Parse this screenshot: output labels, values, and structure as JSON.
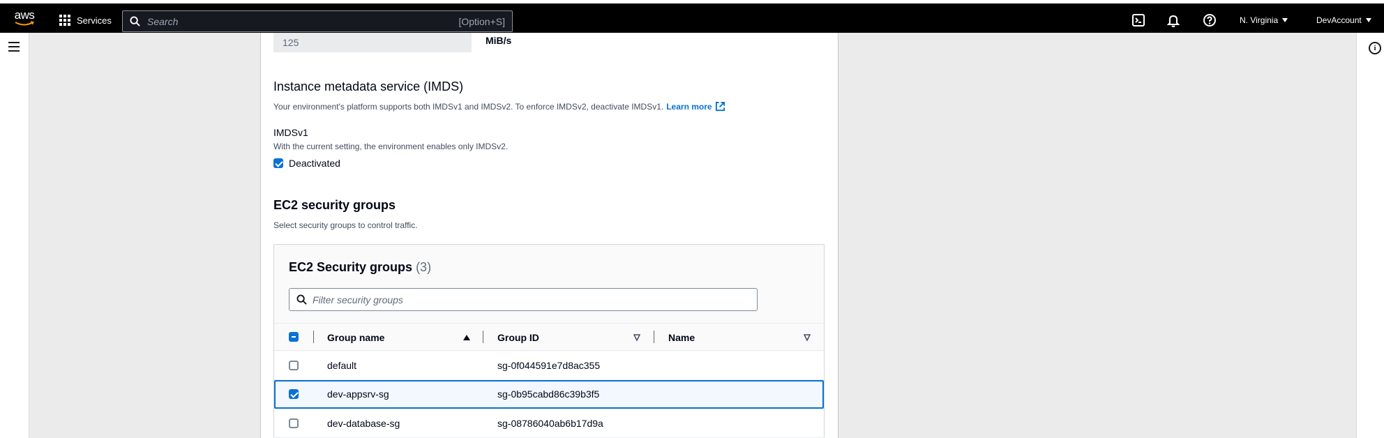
{
  "topbar": {
    "logo_text": "aws",
    "services_label": "Services",
    "search_placeholder": "Search",
    "search_shortcut": "[Option+S]",
    "region": "N. Virginia",
    "account": "DevAccount"
  },
  "throughput": {
    "value": "125",
    "unit": "MiB/s"
  },
  "imds": {
    "heading": "Instance metadata service (IMDS)",
    "description": "Your environment's platform supports both IMDSv1 and IMDSv2. To enforce IMDSv2, deactivate IMDSv1.",
    "learn_more": "Learn more",
    "v1_label": "IMDSv1",
    "v1_description": "With the current setting, the environment enables only IMDSv2.",
    "deactivated_label": "Deactivated",
    "deactivated_checked": true
  },
  "security": {
    "heading": "EC2 security groups",
    "description": "Select security groups to control traffic.",
    "table_title": "EC2 Security groups",
    "table_count": "(3)",
    "filter_placeholder": "Filter security groups",
    "columns": [
      "Group name",
      "Group ID",
      "Name"
    ],
    "rows": [
      {
        "group_name": "default",
        "group_id": "sg-0f044591e7d8ac355",
        "name": "",
        "selected": false
      },
      {
        "group_name": "dev-appsrv-sg",
        "group_id": "sg-0b95cabd86c39b3f5",
        "name": "",
        "selected": true
      },
      {
        "group_name": "dev-database-sg",
        "group_id": "sg-08786040ab6b17d9a",
        "name": "",
        "selected": false
      }
    ]
  },
  "colors": {
    "accent": "#0972d3",
    "topbar": "#000000",
    "page_bg": "#ebebeb"
  }
}
